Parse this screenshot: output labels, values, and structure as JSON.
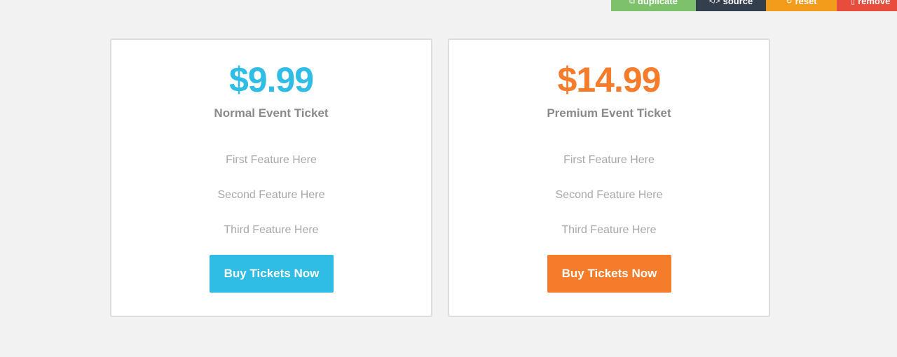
{
  "toolbar": {
    "duplicate": {
      "label": "duplicate",
      "icon": "duplicate-icon",
      "color": "#7dc16b"
    },
    "source": {
      "label": "source",
      "icon": "code-icon",
      "color": "#343f4d"
    },
    "reset": {
      "label": "reset",
      "icon": "reset-icon",
      "color": "#f39c1c"
    },
    "remove": {
      "label": "remove",
      "icon": "trash-icon",
      "color": "#e74c3c"
    }
  },
  "cards": [
    {
      "price": "$9.99",
      "name": "Normal Event Ticket",
      "features": [
        "First Feature Here",
        "Second Feature Here",
        "Third Feature Here"
      ],
      "button": "Buy Tickets Now",
      "accent": "#2fbde6"
    },
    {
      "price": "$14.99",
      "name": "Premium Event Ticket",
      "features": [
        "First Feature Here",
        "Second Feature Here",
        "Third Feature Here"
      ],
      "button": "Buy Tickets Now",
      "accent": "#f57c2b"
    }
  ],
  "colors": {
    "background": "#f2f2f2",
    "card_border": "#dddddd",
    "muted_text": "#a8a8a8",
    "name_text": "#8a8a8a"
  }
}
